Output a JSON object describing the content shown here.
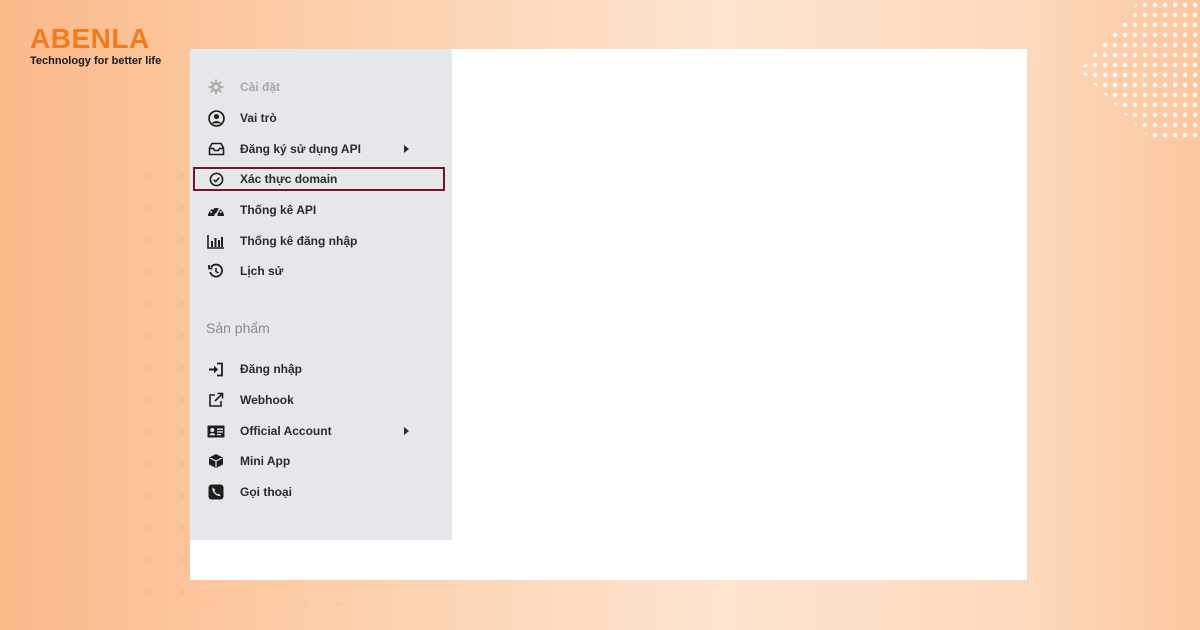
{
  "brand": {
    "name": "ABENLA",
    "tagline": "Technology for better life",
    "color": "#f47a1f"
  },
  "menu": {
    "items": [
      {
        "label": "Cài đặt",
        "icon": "gear-icon",
        "disabled": true
      },
      {
        "label": "Vai trò",
        "icon": "user-circle-icon"
      },
      {
        "label": "Đăng ký sử dụng API",
        "icon": "inbox-icon",
        "has_submenu": true
      },
      {
        "label": "Xác thực domain",
        "icon": "check-circle-icon",
        "highlighted": true
      },
      {
        "label": "Thống kê API",
        "icon": "dashboard-icon"
      },
      {
        "label": "Thống kê đăng nhập",
        "icon": "bar-chart-icon"
      },
      {
        "label": "Lịch sử",
        "icon": "history-icon"
      }
    ],
    "section_heading": "Sản phẩm",
    "product_items": [
      {
        "label": "Đăng nhập",
        "icon": "sign-in-icon"
      },
      {
        "label": "Webhook",
        "icon": "external-link-icon"
      },
      {
        "label": "Official Account",
        "icon": "id-card-icon",
        "has_submenu": true
      },
      {
        "label": "Mini App",
        "icon": "cube-icon"
      },
      {
        "label": "Gọi thoại",
        "icon": "phone-icon"
      }
    ]
  },
  "colors": {
    "sidebar_bg": "#e6e7ea",
    "highlight_border": "#7b1029"
  }
}
